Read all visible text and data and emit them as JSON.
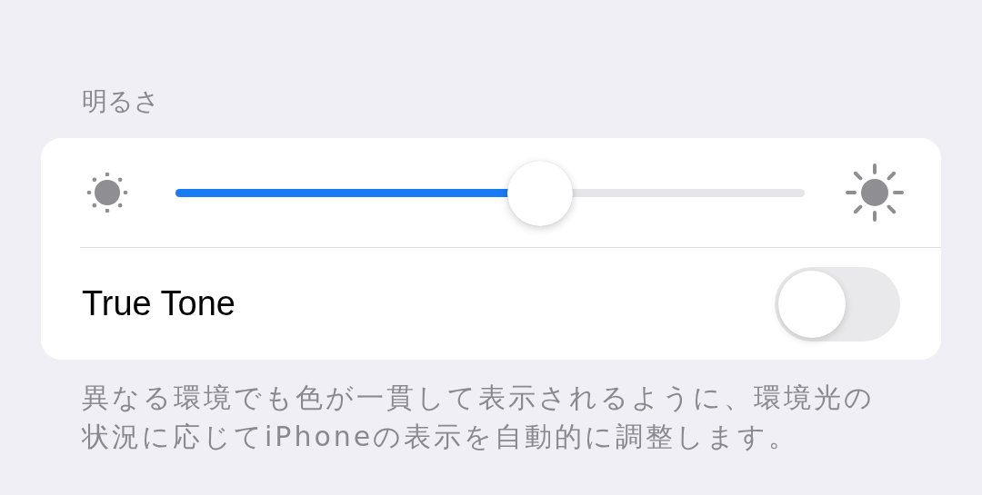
{
  "section": {
    "header": "明るさ"
  },
  "brightness": {
    "level": 0.58
  },
  "true_tone": {
    "label": "True Tone",
    "on": false
  },
  "footer": "異なる環境でも色が一貫して表示されるように、環境光の状況に応じてiPhoneの表示を自動的に調整します。"
}
